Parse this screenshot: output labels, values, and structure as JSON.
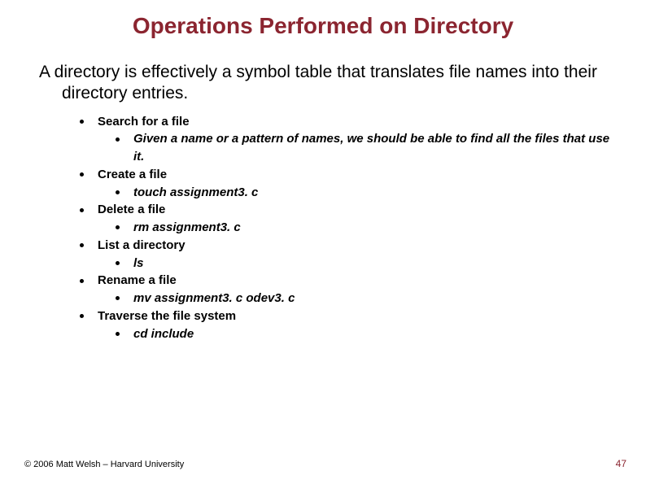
{
  "title": "Operations Performed on Directory",
  "intro": "A directory is effectively a symbol table that translates file names into their directory entries.",
  "items": [
    {
      "label": "Search for a file",
      "sub": "Given a name or a pattern of names, we should be able to find all the files that use it."
    },
    {
      "label": "Create a file",
      "sub": "touch assignment3. c"
    },
    {
      "label": "Delete a file",
      "sub": "rm assignment3. c"
    },
    {
      "label": "List a directory",
      "sub": "ls"
    },
    {
      "label": "Rename a file",
      "sub": "mv assignment3. c odev3. c"
    },
    {
      "label": "Traverse the file system",
      "sub": "cd include"
    }
  ],
  "footer": {
    "copyright": "© 2006 Matt Welsh – Harvard University",
    "page": "47"
  }
}
